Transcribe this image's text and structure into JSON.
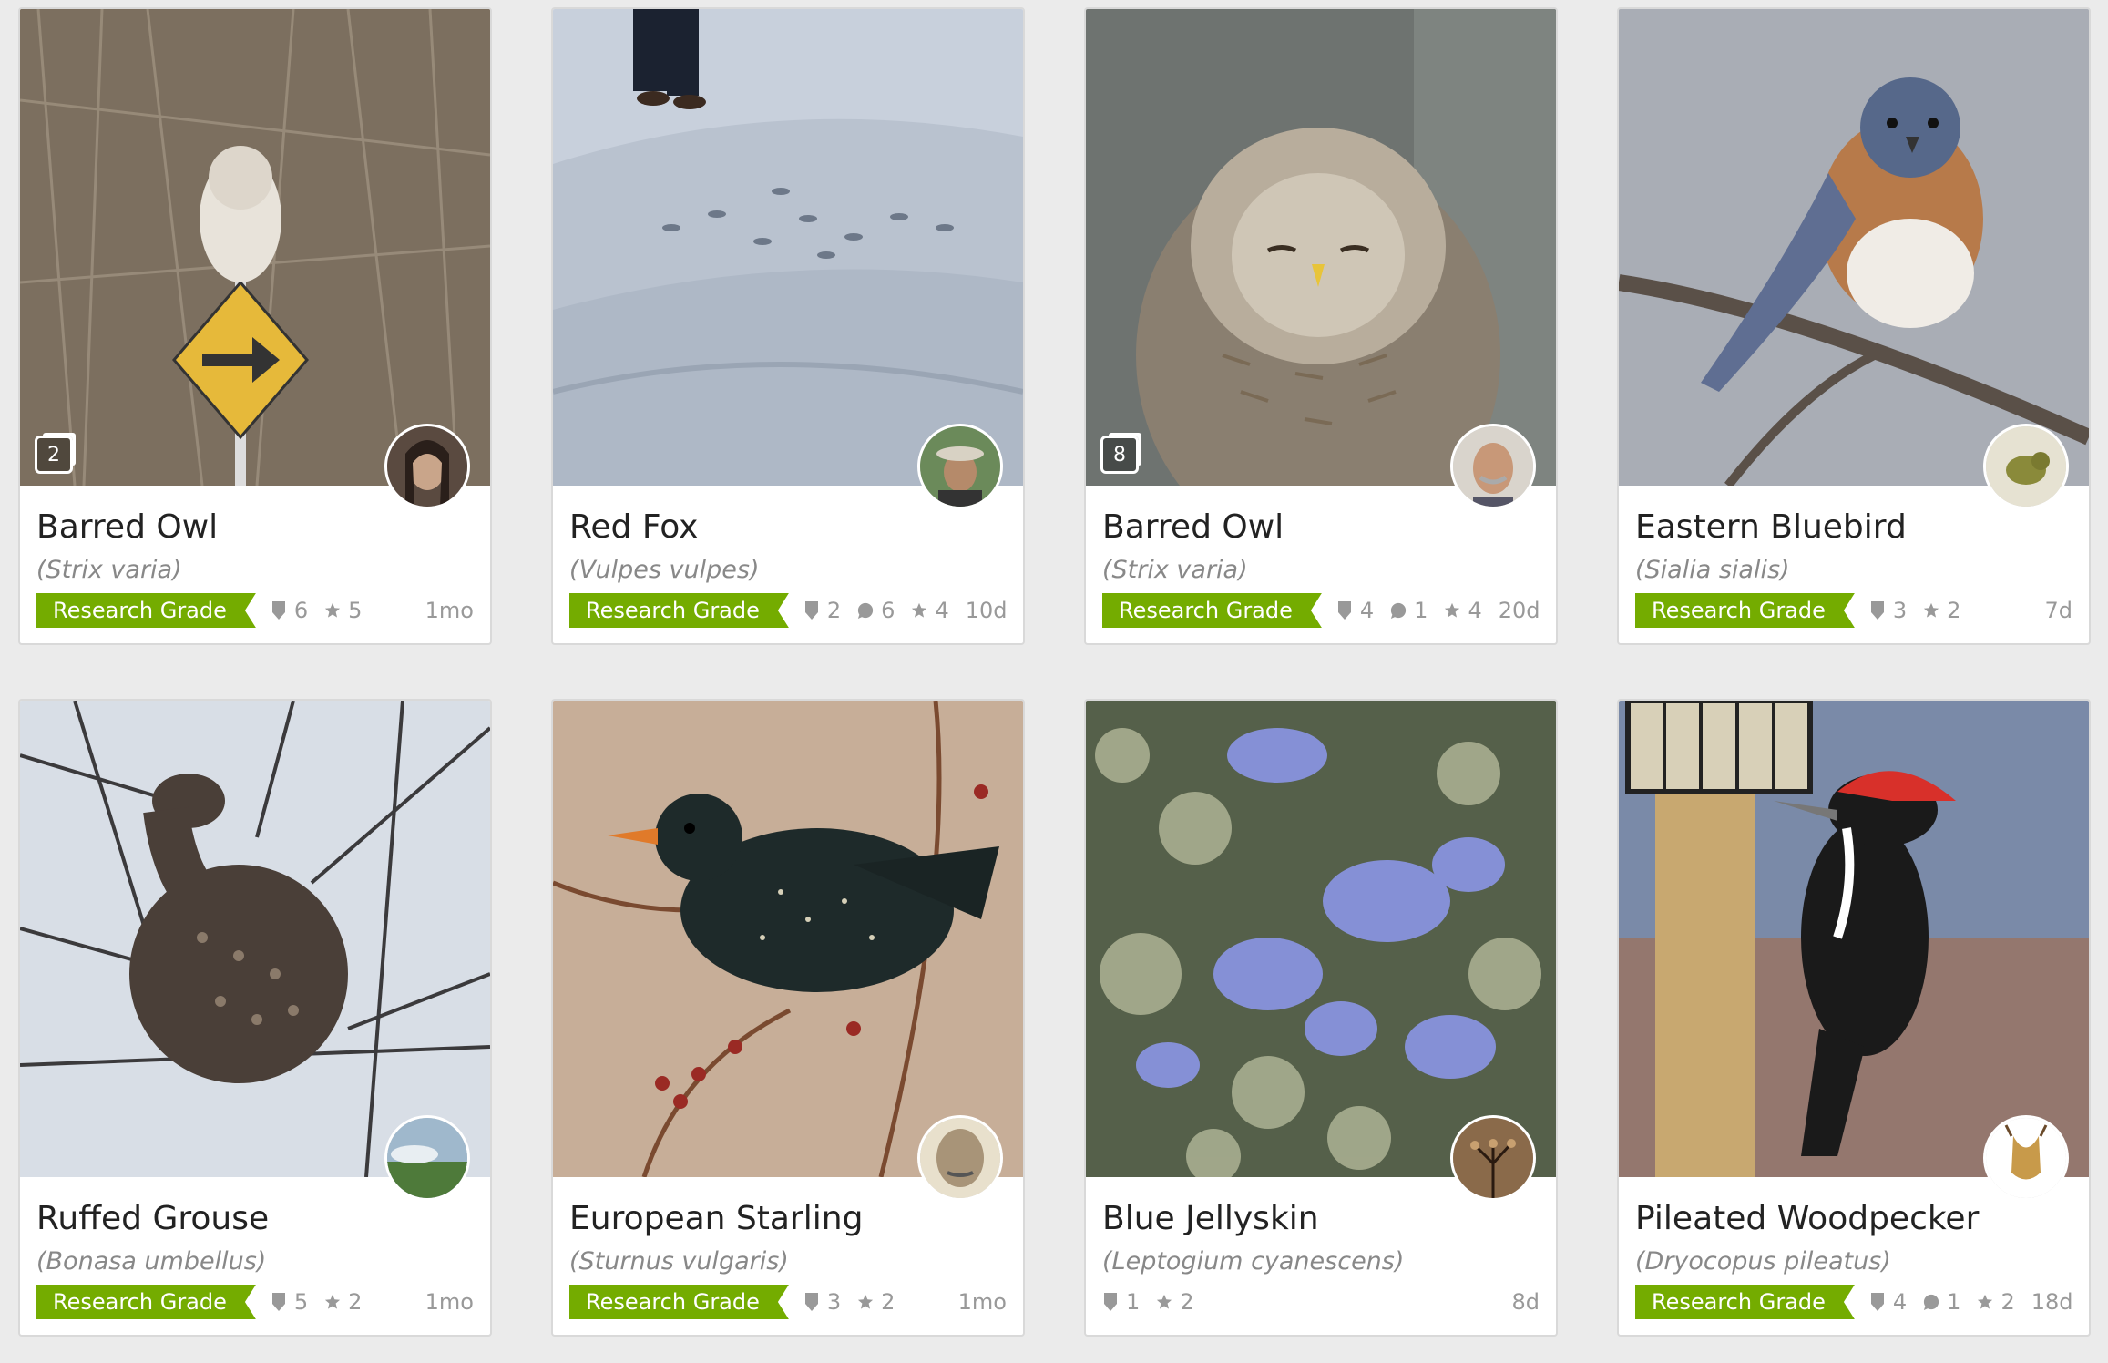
{
  "accent_color": "#74ac00",
  "observations": [
    {
      "name": "Barred Owl",
      "scientific": "(Strix varia)",
      "grade": "Research Grade",
      "photo_count": "2",
      "ids": "6",
      "faves": "5",
      "age": "1mo"
    },
    {
      "name": "Red Fox",
      "scientific": "(Vulpes vulpes)",
      "grade": "Research Grade",
      "ids": "2",
      "comments": "6",
      "faves": "4",
      "age": "10d"
    },
    {
      "name": "Barred Owl",
      "scientific": "(Strix varia)",
      "grade": "Research Grade",
      "photo_count": "8",
      "ids": "4",
      "comments": "1",
      "faves": "4",
      "age": "20d"
    },
    {
      "name": "Eastern Bluebird",
      "scientific": "(Sialia sialis)",
      "grade": "Research Grade",
      "ids": "3",
      "faves": "2",
      "age": "7d"
    },
    {
      "name": "Ruffed Grouse",
      "scientific": "(Bonasa umbellus)",
      "grade": "Research Grade",
      "ids": "5",
      "faves": "2",
      "age": "1mo"
    },
    {
      "name": "European Starling",
      "scientific": "(Sturnus vulgaris)",
      "grade": "Research Grade",
      "ids": "3",
      "faves": "2",
      "age": "1mo"
    },
    {
      "name": "Blue Jellyskin",
      "scientific": "(Leptogium cyanescens)",
      "ids": "1",
      "faves": "2",
      "age": "8d"
    },
    {
      "name": "Pileated Woodpecker",
      "scientific": "(Dryocopus pileatus)",
      "grade": "Research Grade",
      "ids": "4",
      "comments": "1",
      "faves": "2",
      "age": "18d"
    }
  ]
}
